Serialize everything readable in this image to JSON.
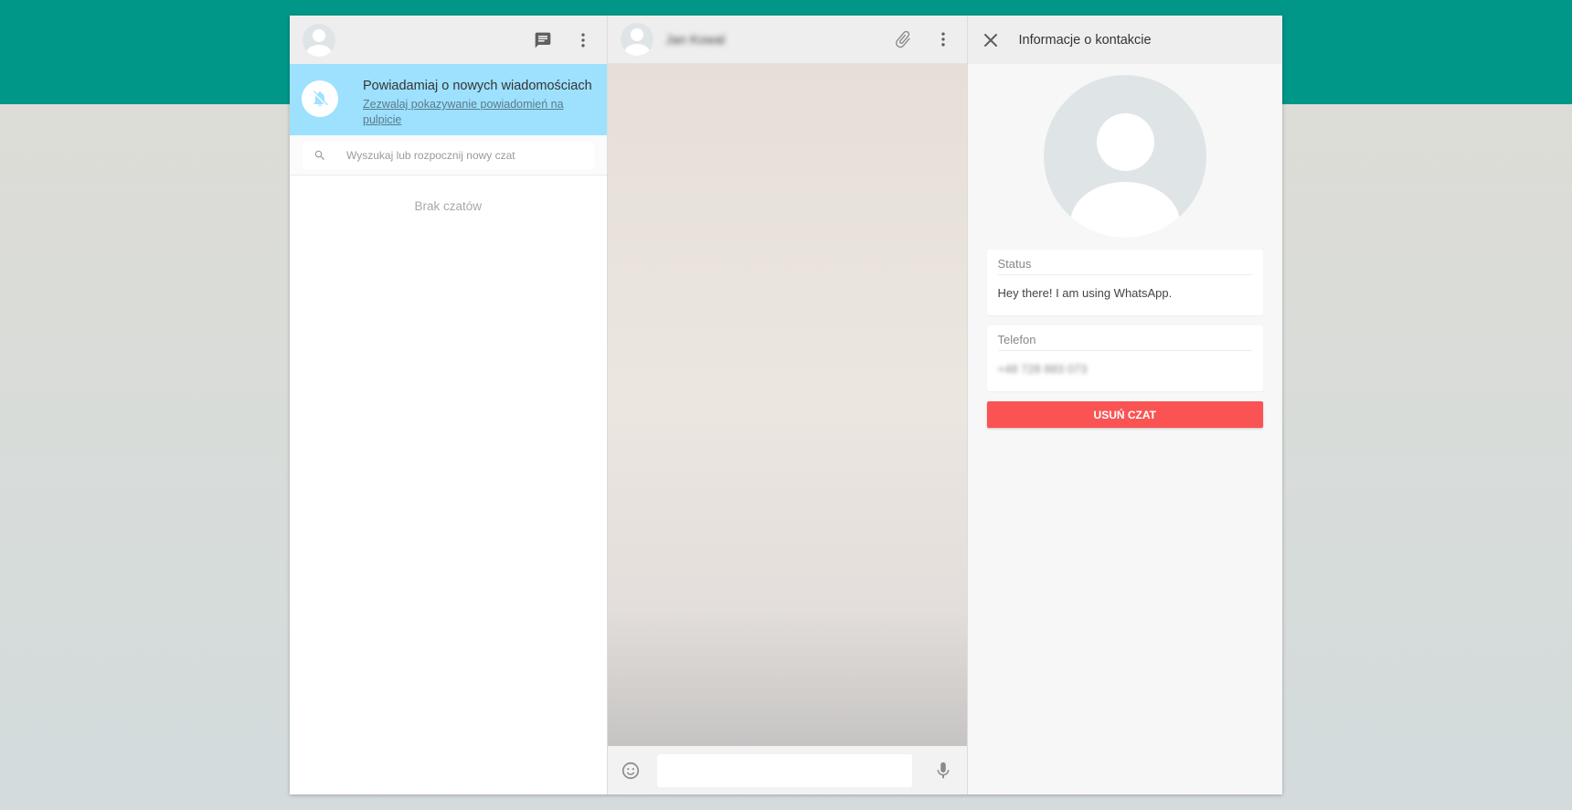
{
  "left_panel": {
    "icons": {
      "avatar": "user-avatar",
      "new_chat": "chat-icon",
      "menu": "more-vert-icon"
    },
    "notification": {
      "icon": "bell-off-icon",
      "title": "Powiadamiaj o nowych wiadomościach",
      "link": "Zezwalaj pokazywanie powiadomień na pulpicie"
    },
    "search": {
      "placeholder": "Wyszukaj lub rozpocznij nowy czat",
      "value": "",
      "icon": "search-icon"
    },
    "empty_state": "Brak czatów"
  },
  "chat_panel": {
    "contact_name": "Jan Kowal",
    "icons": {
      "attach": "paperclip-icon",
      "menu": "more-vert-icon",
      "emoji": "emoji-icon",
      "mic": "microphone-icon"
    },
    "message_input": {
      "placeholder": "",
      "value": ""
    }
  },
  "contact_panel": {
    "title": "Informacje o kontakcie",
    "close_icon": "close-icon",
    "status": {
      "label": "Status",
      "value": "Hey there! I am using WhatsApp."
    },
    "phone": {
      "label": "Telefon",
      "value": "+48 728 883 073"
    },
    "delete_label": "USUŃ CZAT"
  },
  "colors": {
    "brand_band": "#009688",
    "notification_bg": "#9de1fe",
    "delete_button": "#fa5353",
    "panel_header": "#eeeeee"
  }
}
